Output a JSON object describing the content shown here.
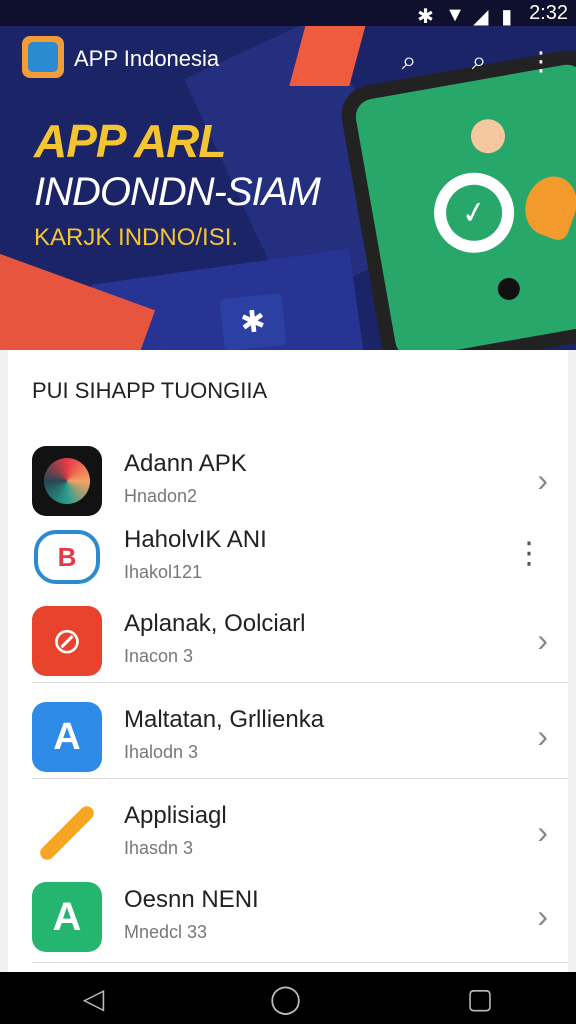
{
  "statusbar": {
    "time": "2:32"
  },
  "hero": {
    "app_title": "APP Indonesia",
    "headline_line1": "APP ARL",
    "headline_line2": "INDONDN-SIAM",
    "headline_line3": "KARJK INDNO/ISI."
  },
  "section": {
    "title": "PUI SIHAPP TUONGIIA"
  },
  "apps": [
    {
      "name": "Adann APK",
      "sub": "Hnadon2"
    },
    {
      "name": "HaholvIK ANI",
      "sub": "Ihakol121"
    },
    {
      "name": "Aplanak, Oolciarl",
      "sub": "Inacon 3"
    },
    {
      "name": "Maltatan, Grllienka",
      "sub": "Ihalodn 3"
    },
    {
      "name": "Applisiagl",
      "sub": "Ihasdn 3"
    },
    {
      "name": "Oesnn NENI",
      "sub": "Mnedcl 33"
    }
  ],
  "colors": {
    "hero_bg": "#1b2466",
    "accent_yellow": "#f5c531",
    "accent_red": "#e8553e",
    "phone_green": "#27a86a"
  }
}
